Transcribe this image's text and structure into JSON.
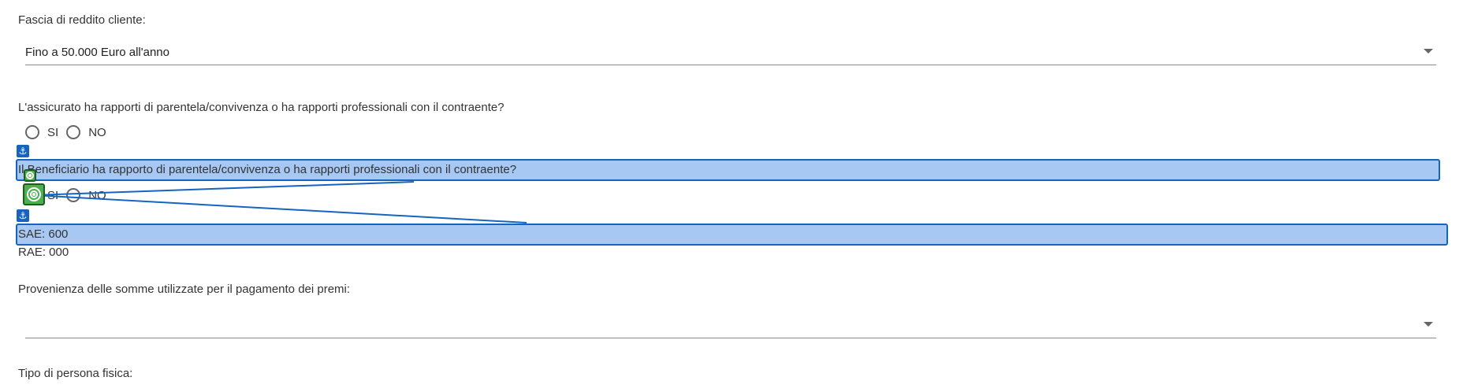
{
  "form": {
    "income_band": {
      "label": "Fascia di reddito cliente:",
      "value": "Fino a 50.000 Euro all'anno"
    },
    "insured_relation": {
      "question": "L'assicurato ha rapporti di parentela/convivenza o ha rapporti professionali con il contraente?",
      "options": [
        "SI",
        "NO"
      ]
    },
    "beneficiary_relation": {
      "question": "Il Beneficiario ha rapporto di parentela/convivenza o ha rapporti professionali con il contraente?",
      "options": [
        "SI",
        "NO"
      ]
    },
    "sae": "SAE: 600",
    "rae": "RAE: 000",
    "funds_origin": {
      "label": "Provenienza delle somme utilizzate per il pagamento dei premi:",
      "value": ""
    },
    "person_type": {
      "label": "Tipo di persona fisica:"
    }
  },
  "overlay": {
    "anchor_glyph": "⚓",
    "highlight_color": "#9fc3f0",
    "highlight_border": "#1565c0",
    "target_color": "#4caf50",
    "icons": [
      "anchor-icon",
      "target-icon"
    ]
  }
}
